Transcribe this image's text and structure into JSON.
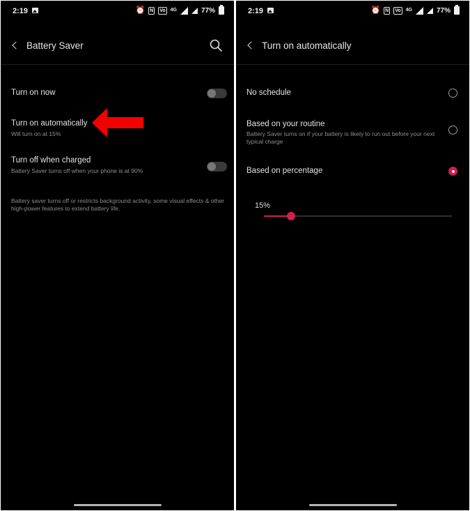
{
  "status_bar": {
    "time": "2:19",
    "battery_pct": "77%",
    "network": "4G"
  },
  "left": {
    "title": "Battery Saver",
    "turn_on_now": {
      "label": "Turn on now",
      "enabled": false
    },
    "turn_on_auto": {
      "label": "Turn on automatically",
      "sub": "Will turn on at 15%"
    },
    "turn_off_charged": {
      "label": "Turn off when charged",
      "sub": "Battery Saver turns off when your phone is at 90%",
      "enabled": false
    },
    "footnote": "Battery saver turns off or restricts background activity, some visual effects & other high-power features to extend battery life."
  },
  "right": {
    "title": "Turn on automatically",
    "options": [
      {
        "label": "No schedule",
        "sub": "",
        "selected": false
      },
      {
        "label": "Based on your routine",
        "sub": "Battery Saver turns on if your battery is likely to run out before your next typical charge",
        "selected": false
      },
      {
        "label": "Based on percentage",
        "sub": "",
        "selected": true
      }
    ],
    "slider": {
      "label": "15%",
      "value": 15,
      "min": 5,
      "max": 75
    }
  },
  "colors": {
    "accent": "#cf2150",
    "annotation_arrow": "#f20000",
    "background": "#000000"
  }
}
